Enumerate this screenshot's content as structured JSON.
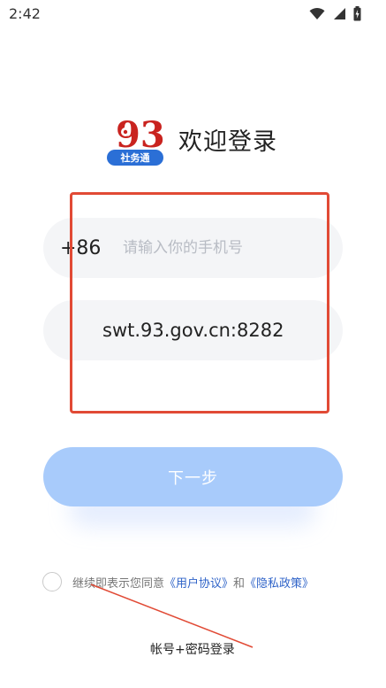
{
  "status_bar": {
    "time": "2:42",
    "icons": [
      "wifi-icon",
      "signal-icon",
      "battery-icon"
    ]
  },
  "brand": {
    "logo_number": "93",
    "logo_subtitle": "社务通",
    "welcome": "欢迎登录"
  },
  "login": {
    "country_code": "+86",
    "phone_placeholder": "请输入你的手机号",
    "server_value": "swt.93.gov.cn:8282",
    "next_label": "下一步"
  },
  "agreement": {
    "prefix": "继续即表示您同意",
    "user_agreement": "《用户协议》",
    "and": "和",
    "privacy_policy": "《隐私政策》"
  },
  "alt_login": {
    "label": "帐号+密码登录"
  },
  "colors": {
    "accent": "#a8cbfb",
    "link": "#2f63c8",
    "annotation": "#e14a35",
    "field_bg": "#f4f5f7"
  }
}
